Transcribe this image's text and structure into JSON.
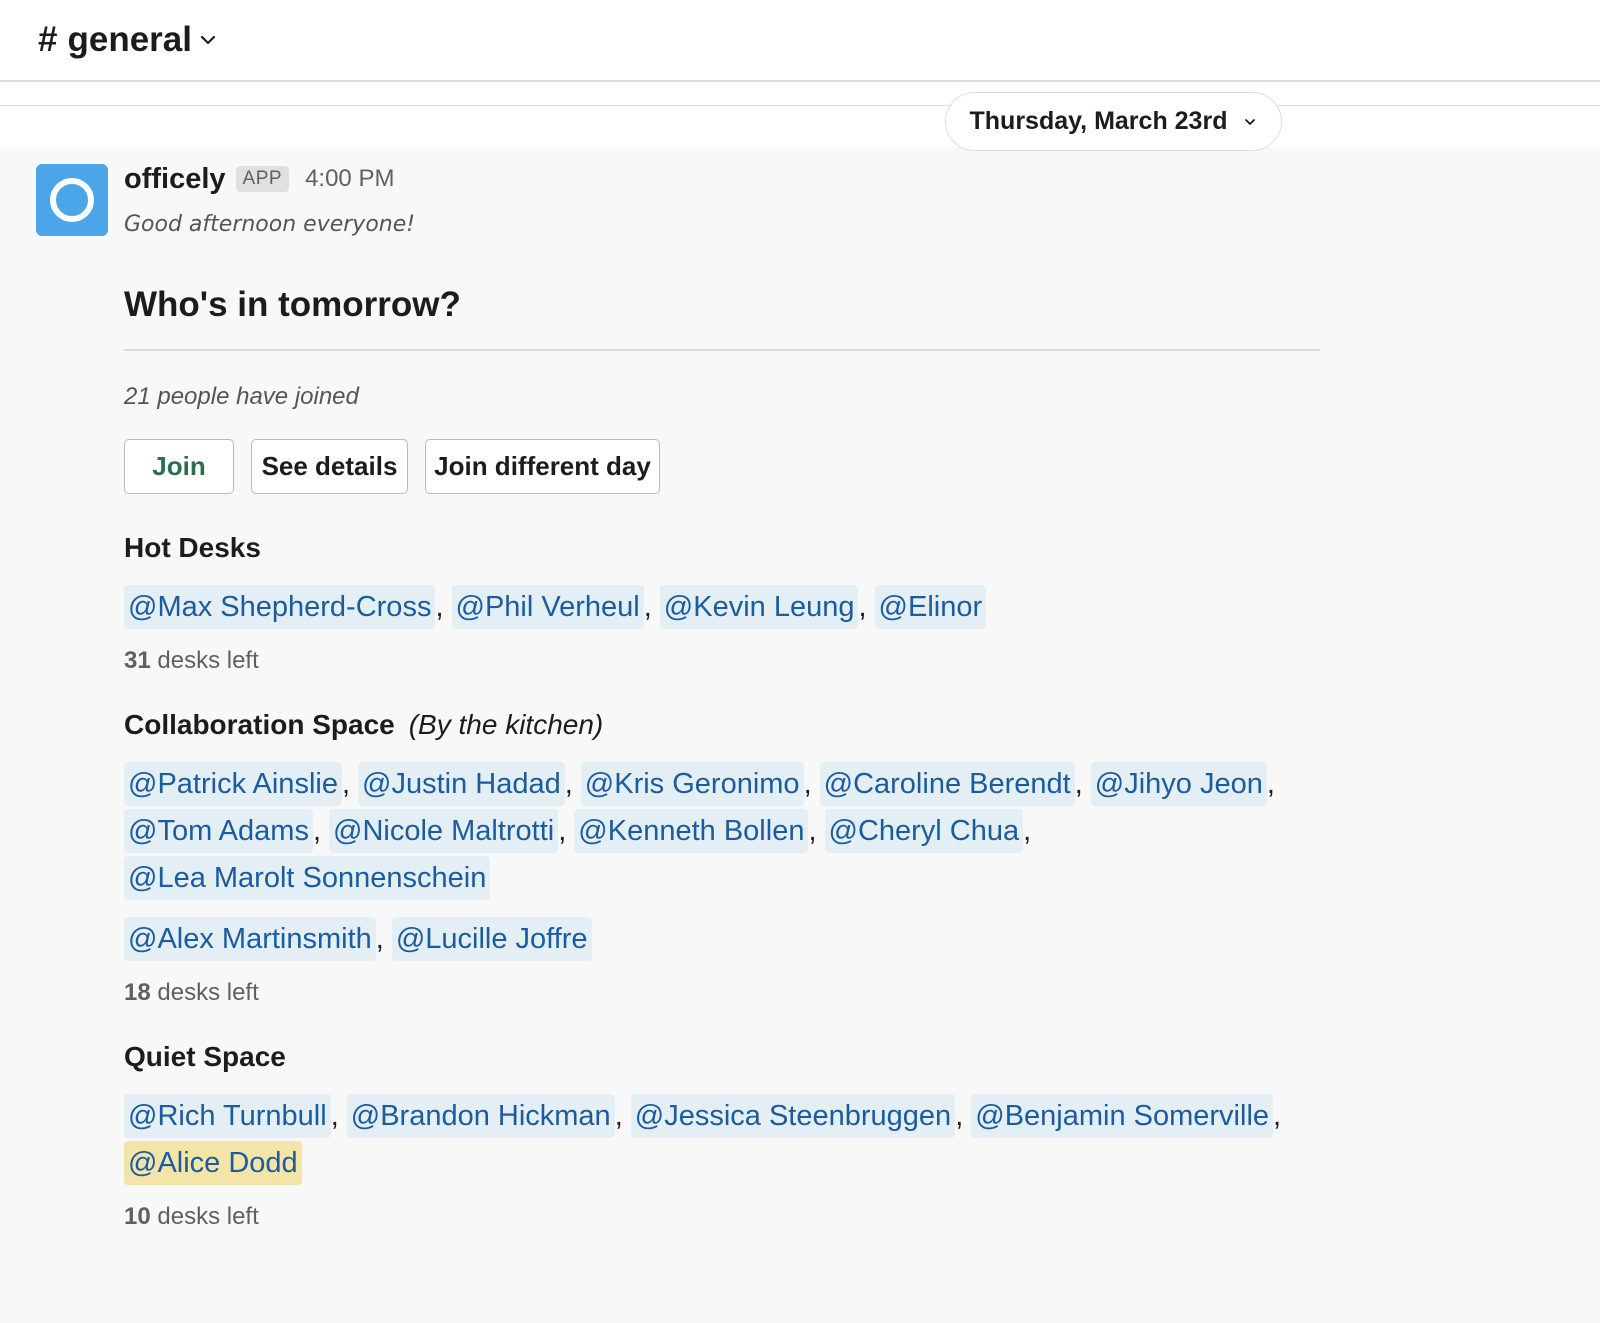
{
  "header": {
    "hash": "#",
    "channel": "general",
    "icon": "chevron-down-icon"
  },
  "date_divider": {
    "label": "Thursday, March 23rd",
    "icon": "chevron-down-icon"
  },
  "message": {
    "sender": "officely",
    "badge": "APP",
    "time": "4:00 PM",
    "greeting": "Good afternoon everyone!",
    "avatar_color": "#4aa6e8"
  },
  "poll": {
    "title": "Who's in tomorrow?",
    "joined_text": "21 people have joined",
    "buttons": {
      "join": "Join",
      "see_details": "See details",
      "join_different_day": "Join different day"
    },
    "accent_color": "#2c6e4a"
  },
  "sections": {
    "hot_desks": {
      "title": "Hot Desks",
      "mentions": [
        "@Max Shepherd-Cross",
        "@Phil Verheul",
        "@Kevin Leung",
        "@Elinor"
      ],
      "desks_count": "31",
      "desks_suffix": "desks left"
    },
    "collab": {
      "title": "Collaboration Space",
      "note": "(By the kitchen)",
      "mentions_a": [
        "@Patrick Ainslie",
        "@Justin Hadad",
        "@Kris Geronimo",
        "@Caroline Berendt",
        "@Jihyo Jeon",
        "@Tom Adams",
        "@Nicole Maltrotti",
        "@Kenneth Bollen",
        "@Cheryl Chua",
        "@Lea Marolt Sonnenschein"
      ],
      "mentions_b": [
        "@Alex Martinsmith",
        "@Lucille Joffre"
      ],
      "desks_count": "18",
      "desks_suffix": "desks left"
    },
    "quiet": {
      "title": "Quiet Space",
      "mentions": [
        "@Rich Turnbull",
        "@Brandon Hickman",
        "@Jessica Steenbruggen",
        "@Benjamin Somerville",
        "@Alice Dodd"
      ],
      "highlighted_mention": "@Alice Dodd",
      "desks_count": "10",
      "desks_suffix": "desks left"
    }
  },
  "colors": {
    "mention_bg": "#e3eef5",
    "mention_text": "#1a5c9e",
    "self_mention_bg": "#f5e4a8"
  }
}
